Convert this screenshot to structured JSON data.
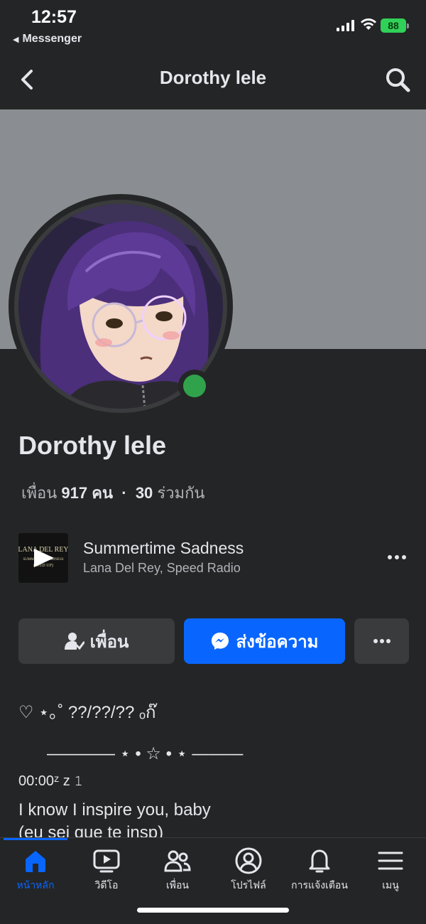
{
  "status_bar": {
    "time": "12:57",
    "back_app": "Messenger",
    "battery": "88"
  },
  "nav": {
    "title": "Dorothy lele"
  },
  "profile": {
    "name": "Dorothy lele",
    "friends_prefix": "เพื่อน",
    "friends_count": "917",
    "friends_unit": "คน",
    "separator": "·",
    "mutual_count": "30",
    "mutual_label": "ร่วมกัน"
  },
  "music": {
    "title": "Summertime Sadness",
    "artist": "Lana Del Rey, Speed Radio",
    "art_text_1": "LANA DEL REY",
    "art_text_2": "SUMMERTIME SADNESS",
    "art_text_3": "(SPED UP)"
  },
  "actions": {
    "friend_label": "เพื่อน",
    "message_label": "ส่งข้อความ"
  },
  "bio": {
    "line1": "♡ ⋆｡˚ ??/??/?? ₒ⁠ก๊",
    "line2": "———— ⋆ • ☆ • ⋆ ———",
    "line3": "00:00ᶻ z 𝟷",
    "line4": "I know I inspire you, baby",
    "line5": "(eu sei que te insp)"
  },
  "tabs": [
    {
      "label": "หน้าหลัก",
      "icon": "home-icon",
      "active": true
    },
    {
      "label": "วิดีโอ",
      "icon": "video-icon"
    },
    {
      "label": "เพื่อน",
      "icon": "friends-icon"
    },
    {
      "label": "โปรไฟล์",
      "icon": "profile-icon"
    },
    {
      "label": "การแจ้งเตือน",
      "icon": "bell-icon"
    },
    {
      "label": "เมนู",
      "icon": "menu-icon"
    }
  ],
  "colors": {
    "accent": "#0866ff",
    "online": "#31a24c",
    "background": "#242526",
    "cover": "#8a8d91"
  }
}
